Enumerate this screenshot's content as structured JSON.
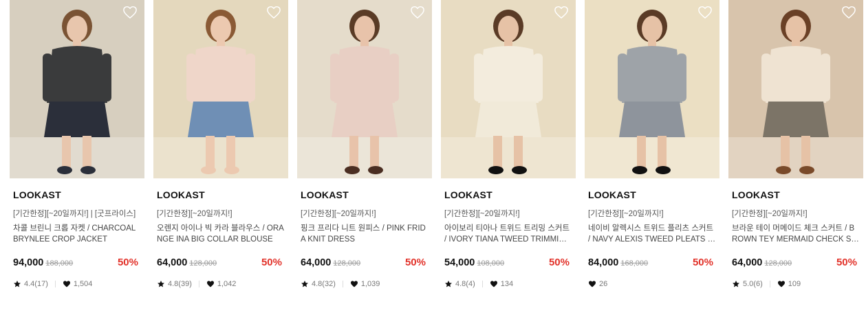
{
  "products": [
    {
      "brand": "LOOKAST",
      "promo": "[기간한정][~20일까지!] | [굿프라이스]",
      "name": "차콜 브린니 크롭 자켓 / CHARCOAL BRYNLEE CROP JACKET",
      "price": "94,000",
      "original_price": "188,000",
      "discount": "50%",
      "rating": "4.4(17)",
      "likes": "1,504",
      "photo": {
        "bg": "#d7cfbf",
        "top": "#3a3b3c",
        "bottom": "#2b2f3a",
        "skin": "#e8c6ad",
        "hair": "#7a5334",
        "shoe": "#2b2f3a"
      }
    },
    {
      "brand": "LOOKAST",
      "promo": "[기간한정][~20일까지!]",
      "name": "오렌지 아이나 빅 카라 블라우스 / ORANGE INA BIG COLLAR BLOUSE",
      "price": "64,000",
      "original_price": "128,000",
      "discount": "50%",
      "rating": "4.8(39)",
      "likes": "1,042",
      "photo": {
        "bg": "#e4d8bd",
        "top": "#efd6c9",
        "bottom": "#6f8fb5",
        "skin": "#ecc9b0",
        "hair": "#8a5a35",
        "shoe": "#ecc9b0"
      }
    },
    {
      "brand": "LOOKAST",
      "promo": "[기간한정][~20일까지!]",
      "name": "핑크 프리다 니트 원피스 / PINK FRIDA KNIT DRESS",
      "price": "64,000",
      "original_price": "128,000",
      "discount": "50%",
      "rating": "4.8(32)",
      "likes": "1,039",
      "photo": {
        "bg": "#e5dccb",
        "top": "#e8cfc4",
        "bottom": "#e8cfc4",
        "skin": "#e8c3aa",
        "hair": "#5a3b26",
        "shoe": "#4b2e22"
      }
    },
    {
      "brand": "LOOKAST",
      "promo": "[기간한정][~20일까지!]",
      "name": "아이보리 티아나 트위드 트리밍 스커트 / IVORY TIANA TWEED TRIMMING SKIRT",
      "price": "54,000",
      "original_price": "108,000",
      "discount": "50%",
      "rating": "4.8(4)",
      "likes": "134",
      "photo": {
        "bg": "#e8dcc2",
        "top": "#f3ecdd",
        "bottom": "#f1ead9",
        "skin": "#e6c2a6",
        "hair": "#5a3b26",
        "shoe": "#111111"
      }
    },
    {
      "brand": "LOOKAST",
      "promo": "[기간한정][~20일까지!]",
      "name": "네이비 알렉시스 트위드 플리츠 스커트 / NAVY ALEXIS TWEED PLEATS SKIRT",
      "price": "84,000",
      "original_price": "168,000",
      "discount": "50%",
      "rating": "",
      "likes": "26",
      "photo": {
        "bg": "#ebdfc3",
        "top": "#9ea3a8",
        "bottom": "#8e949c",
        "skin": "#e6c2a6",
        "hair": "#5a3b26",
        "shoe": "#111111"
      }
    },
    {
      "brand": "LOOKAST",
      "promo": "[기간한정][~20일까지!]",
      "name": "브라운 테이 머메이드 체크 스커트 / BROWN TEY MERMAID CHECK SKIRT",
      "price": "64,000",
      "original_price": "128,000",
      "discount": "50%",
      "rating": "5.0(6)",
      "likes": "109",
      "photo": {
        "bg": "#d8c4ac",
        "top": "#efe3d2",
        "bottom": "#7c7467",
        "skin": "#e6c2a6",
        "hair": "#6a4026",
        "shoe": "#7a4a2a"
      }
    }
  ],
  "colors": {
    "discount": "#e2322a",
    "brand_text": "#111111",
    "muted": "#777777"
  },
  "icons": {
    "wishlist": "heart-outline-icon",
    "rating": "star-icon",
    "likes": "heart-icon"
  }
}
